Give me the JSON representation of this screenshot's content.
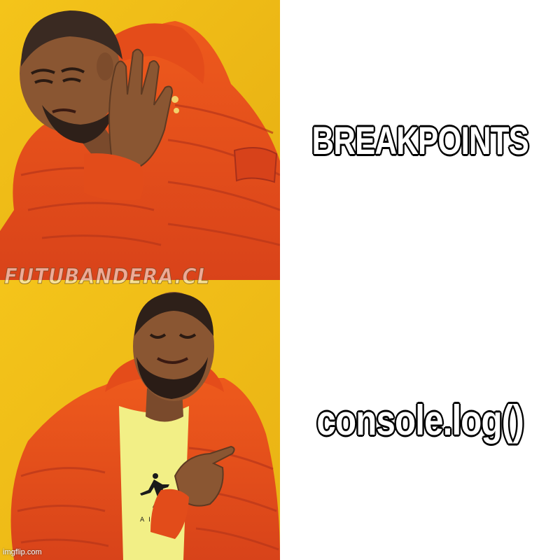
{
  "panels": [
    {
      "caption": "BREAKPOINTS",
      "reaction": "rejecting"
    },
    {
      "caption": "console.log()",
      "reaction": "approving"
    }
  ],
  "watermark": "FUTUBANDERA.CL",
  "credit": "imgflip.com",
  "colors": {
    "background": "#f1bd1a",
    "jacket": "#e8501a",
    "text_fill": "#ffffff",
    "text_outline": "#000000"
  }
}
